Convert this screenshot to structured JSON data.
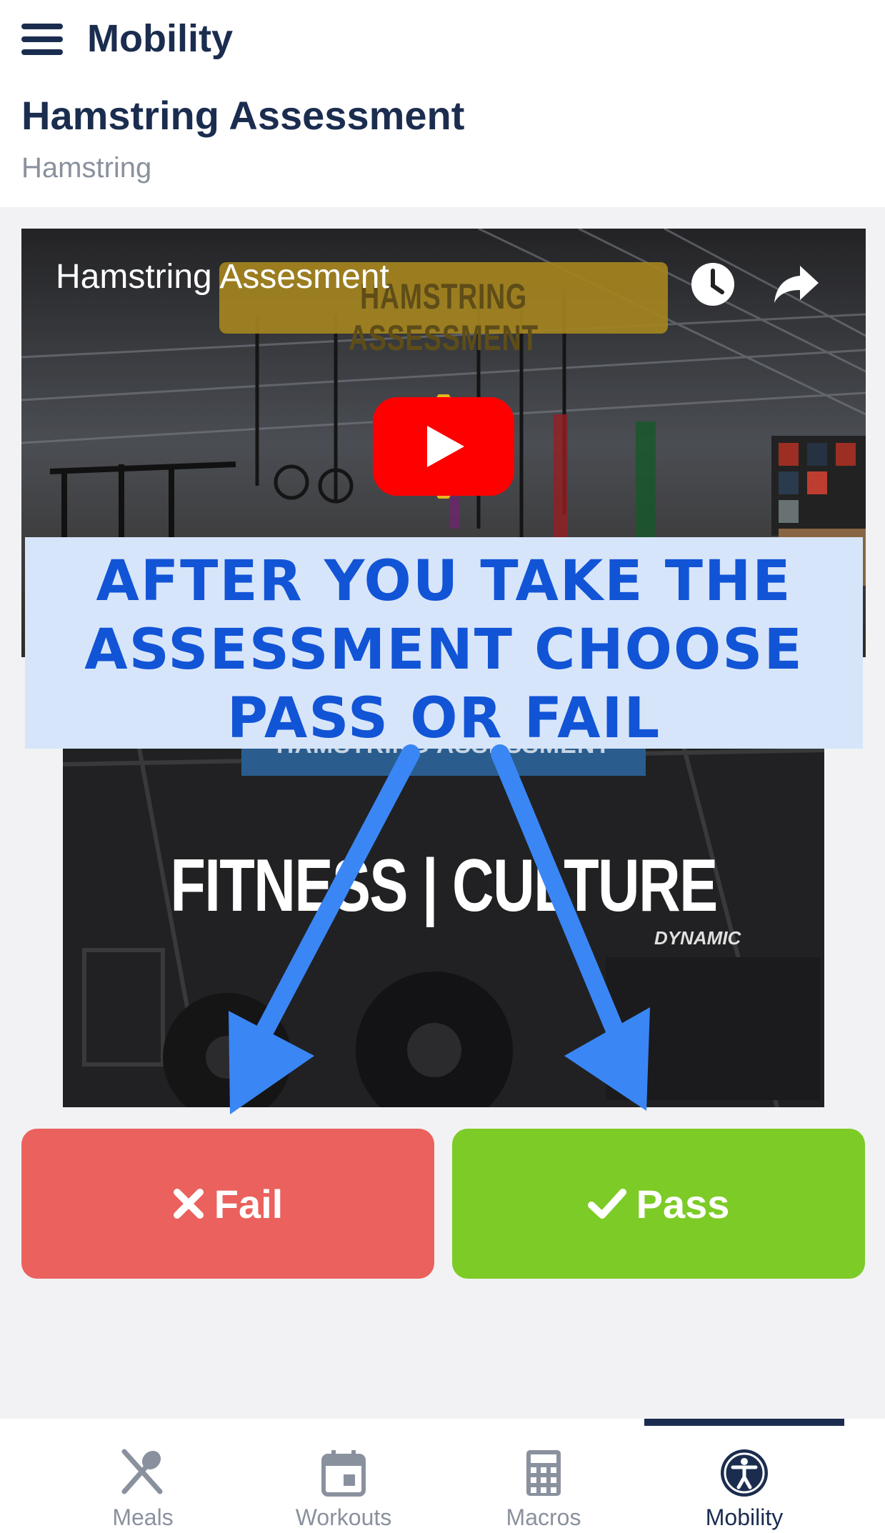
{
  "header": {
    "app_title": "Mobility",
    "page_title": "Hamstring Assessment",
    "page_subtitle": "Hamstring"
  },
  "video1": {
    "title": "Hamstring Assesment",
    "thumbnail_banner": "HAMSTRING ASSESSMENT"
  },
  "video2": {
    "thumbnail_banner": "HAMSTRING ASSESSMENT",
    "logo_text": "FITNESS | CULTURE",
    "equipment_label": "DYNAMIC"
  },
  "instruction": {
    "text": "After you take the assessment choose pass or fail"
  },
  "buttons": {
    "fail_label": "Fail",
    "pass_label": "Pass"
  },
  "nav": {
    "items": [
      {
        "label": "Meals",
        "icon": "meals-icon"
      },
      {
        "label": "Workouts",
        "icon": "calendar-icon"
      },
      {
        "label": "Macros",
        "icon": "calculator-icon"
      },
      {
        "label": "Mobility",
        "icon": "accessibility-icon"
      }
    ],
    "active": "Mobility"
  },
  "colors": {
    "brand_navy": "#1b2d4f",
    "fail_red": "#ea615d",
    "pass_green": "#7dcb26",
    "instruction_blue": "#1254d6",
    "instruction_bg": "#d7e5fb",
    "arrow_blue": "#3a86f5",
    "youtube_red": "#ff0000",
    "banner_gold": "#c9a227"
  }
}
